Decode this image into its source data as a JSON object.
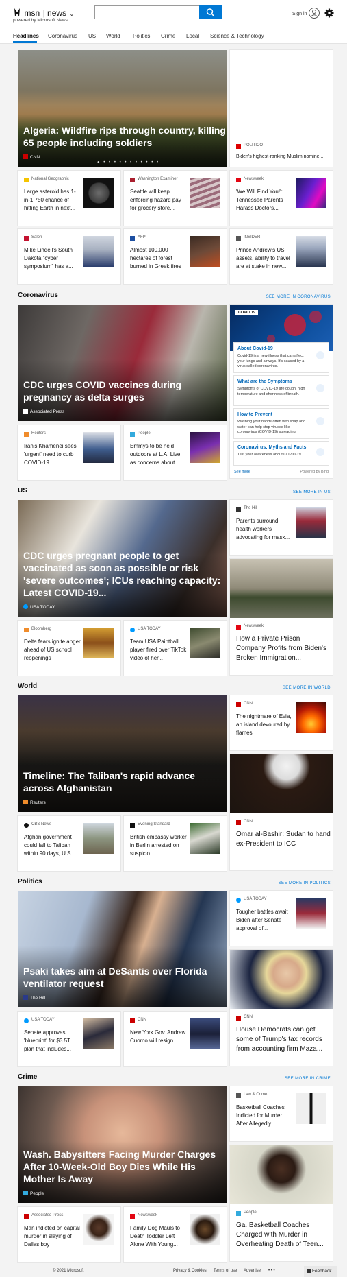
{
  "header": {
    "brand_msn": "msn",
    "brand_news": "news",
    "powered_by": "powered by Microsoft News",
    "search_placeholder": "",
    "sign_in": "Sign in"
  },
  "nav": {
    "items": [
      "Headlines",
      "Coronavirus",
      "US",
      "World",
      "Politics",
      "Crime",
      "Local",
      "Science & Technology"
    ],
    "active": "Headlines"
  },
  "colors": {
    "accent": "#0078d4",
    "background": "#f3f3f3"
  },
  "top": {
    "hero": {
      "title": "Algeria: Wildfire rips through country, killing 65 people including soldiers",
      "source": "CNN"
    },
    "side_card": {
      "source": "POLITICO",
      "title": "Biden's highest-ranking Muslim nomine..."
    },
    "row1": [
      {
        "source": "National Geographic",
        "title": "Large asteroid has 1-in-1,750 chance of hitting Earth in next..."
      },
      {
        "source": "Washington Examiner",
        "title": "Seattle will keep enforcing hazard pay for grocery store..."
      },
      {
        "source": "Newsweek",
        "title": "'We Will Find You!': Tennessee Parents Harass Doctors..."
      }
    ],
    "row2": [
      {
        "source": "Salon",
        "title": "Mike Lindell's South Dakota \"cyber symposium\" has a..."
      },
      {
        "source": "AFP",
        "title": "Almost 100,000 hectares of forest burned in Greek fires"
      },
      {
        "source": "INSIDER",
        "title": "Prince Andrew's US assets, ability to travel are at stake in new..."
      }
    ]
  },
  "coronavirus": {
    "title": "Coronavirus",
    "see_more": "SEE MORE IN CORONAVIRUS",
    "hero": {
      "title": "CDC urges COVID vaccines during pregnancy as delta surges",
      "source": "Associated Press"
    },
    "cards": [
      {
        "source": "Reuters",
        "title": "Iran's Khamenei sees 'urgent' need to curb COVID-19"
      },
      {
        "source": "People",
        "title": "Emmys to be held outdoors at L.A. Live as concerns about..."
      }
    ],
    "widget": {
      "tag": "COVID 19",
      "items": [
        {
          "title": "About Covid-19",
          "text": "Covid-19 is a new illness that can affect your lungs and airways. It's caused by a virus called coronavirus."
        },
        {
          "title": "What are the Symptoms",
          "text": "Symptoms of COVID-19 are cough, high temperature and shortness of breath."
        },
        {
          "title": "How to Prevent",
          "text": "Washing your hands often with soap and water can help stop viruses like coronavirus (COVID-19) spreading."
        },
        {
          "title": "Coronavirus: Myths and Facts",
          "text": "Test your awareness about COVID-19."
        }
      ],
      "see_more": "See more",
      "powered": "Powered by Bing"
    }
  },
  "us": {
    "title": "US",
    "see_more": "SEE MORE IN US",
    "hero": {
      "title": "CDC urges pregnant people to get vaccinated as soon as possible or risk 'severe outcomes'; ICUs reaching capacity: Latest COVID-19...",
      "source": "USA TODAY"
    },
    "side_card": {
      "source": "The Hill",
      "title": "Parents surround health workers advocating for mask..."
    },
    "big_card": {
      "source": "Newsweek",
      "title": "How a Private Prison Company Profits from Biden's Broken Immigration..."
    },
    "cards": [
      {
        "source": "Bloomberg",
        "title": "Delta fears ignite anger ahead of US school reopenings"
      },
      {
        "source": "USA TODAY",
        "title": "Team USA Paintball player fired over TikTok video of her..."
      }
    ]
  },
  "world": {
    "title": "World",
    "see_more": "SEE MORE IN WORLD",
    "hero": {
      "title": "Timeline: The Taliban's rapid advance across Afghanistan",
      "source": "Reuters"
    },
    "side_card": {
      "source": "CNN",
      "title": "The nightmare of Evia, an island devoured by flames"
    },
    "big_card": {
      "source": "CNN",
      "title": "Omar al-Bashir: Sudan to hand ex-President to ICC"
    },
    "cards": [
      {
        "source": "CBS News",
        "title": "Afghan government could fall to Taliban within 90 days, U.S...."
      },
      {
        "source": "Evening Standard",
        "title": "British embassy worker in Berlin arrested on suspicio..."
      }
    ]
  },
  "politics": {
    "title": "Politics",
    "see_more": "SEE MORE IN POLITICS",
    "hero": {
      "title": "Psaki takes aim at DeSantis over Florida ventilator request",
      "source": "The Hill"
    },
    "side_card": {
      "source": "USA TODAY",
      "title": "Tougher battles await Biden after Senate approval of..."
    },
    "big_card": {
      "source": "CNN",
      "title": "House Democrats can get some of Trump's tax records from accounting firm Maza..."
    },
    "cards": [
      {
        "source": "USA TODAY",
        "title": "Senate approves 'blueprint' for $3.5T plan that includes..."
      },
      {
        "source": "CNN",
        "title": "New York Gov. Andrew Cuomo will resign"
      }
    ]
  },
  "crime": {
    "title": "Crime",
    "see_more": "SEE MORE IN CRIME",
    "hero": {
      "title": "Wash. Babysitters Facing Murder Charges After 10-Week-Old Boy Dies While His Mother Is Away",
      "source": "People"
    },
    "side_card": {
      "source": "Law & Crime",
      "title": "Basketball Coaches Indicted for Murder After Allegedly..."
    },
    "big_card": {
      "source": "People",
      "title": "Ga. Basketball Coaches Charged with Murder in Overheating Death of Teen..."
    },
    "cards": [
      {
        "source": "Associated Press",
        "title": "Man indicted on capital murder in slaying of Dallas boy"
      },
      {
        "source": "Newsweek",
        "title": "Family Dog Mauls to Death Toddler Left Alone With Young..."
      }
    ]
  },
  "footer": {
    "copyright": "© 2021 Microsoft",
    "links": [
      "Privacy & Cookies",
      "Terms of use",
      "Advertise"
    ],
    "more": "• • •",
    "feedback": "Feedback"
  }
}
